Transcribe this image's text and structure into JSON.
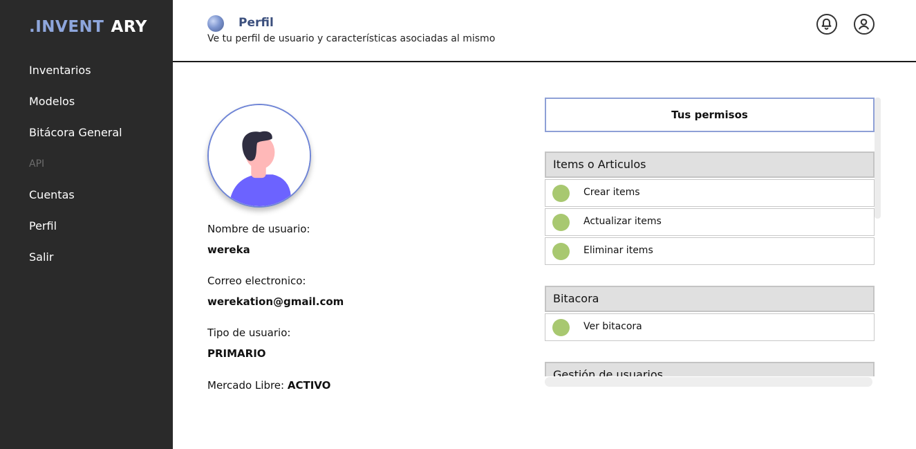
{
  "app": {
    "logo_part1": ".INVENT",
    "logo_part2": "ARY"
  },
  "sidebar": {
    "items": [
      {
        "label": "Inventarios"
      },
      {
        "label": "Modelos"
      },
      {
        "label": "Bitácora General"
      },
      {
        "label": "API",
        "disabled": true
      },
      {
        "label": "Cuentas"
      },
      {
        "label": "Perfil"
      },
      {
        "label": "Salir"
      }
    ]
  },
  "header": {
    "title": "Perfil",
    "subtitle": "Ve tu perfil de usuario y características asociadas al mismo",
    "icons": [
      "bell-icon",
      "user-circle-icon"
    ]
  },
  "profile": {
    "username_label": "Nombre de usuario:",
    "username": "wereka",
    "email_label": "Correo electronico:",
    "email": "werekation@gmail.com",
    "type_label": "Tipo de usuario:",
    "type": "PRIMARIO",
    "ml_label": "Mercado Libre:",
    "ml_status": "ACTIVO"
  },
  "permissions": {
    "title": "Tus permisos",
    "groups": [
      {
        "title": "Items o Articulos",
        "items": [
          "Crear items",
          "Actualizar items",
          "Eliminar items"
        ]
      },
      {
        "title": "Bitacora",
        "items": [
          "Ver bitacora"
        ]
      },
      {
        "title": "Gestión de usuarios",
        "items": []
      }
    ],
    "status_color": "#a8c870"
  },
  "colors": {
    "sidebar_bg": "#2a2a2a",
    "accent": "#8ea6dc",
    "header_title": "#3b4f7d",
    "group_bg": "#e0e0e0"
  }
}
